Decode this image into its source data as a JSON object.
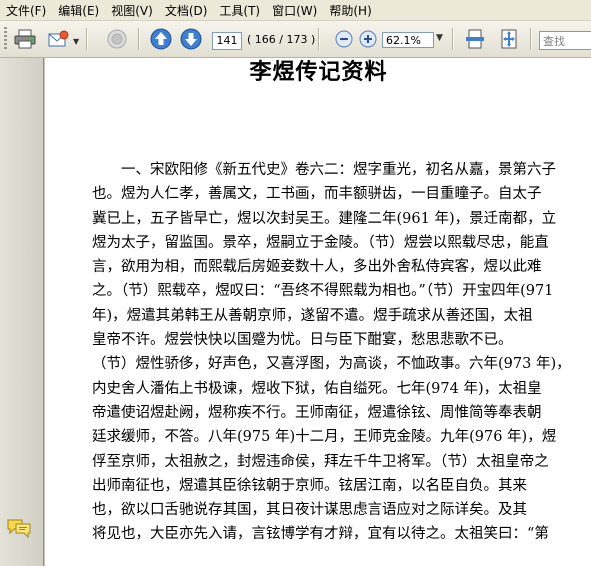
{
  "menu": {
    "items": [
      "文件(F)",
      "编辑(E)",
      "视图(V)",
      "文档(D)",
      "工具(T)",
      "窗口(W)",
      "帮助(H)"
    ]
  },
  "toolbar": {
    "page_current": "141",
    "page_of": "( 166 / 173 )",
    "zoom": "62.1%",
    "zoom_dropdown_arrow": "▼",
    "search_placeholder": "查找",
    "icons": [
      "printer-icon",
      "email-icon",
      "disabled-circle-icon",
      "up-arrow-icon",
      "down-arrow-icon",
      "zoom-out-icon",
      "zoom-in-icon",
      "fit-width-icon",
      "fit-page-icon"
    ]
  },
  "document": {
    "title": "李煜传记资料",
    "lines": [
      "　　一、宋欧阳修《新五代史》卷六二：煜字重光，初名从嘉，景第六子",
      "也。煜为人仁孝，善属文，工书画，而丰额骈齿，一目重瞳子。自太子",
      "冀已上，五子皆早亡，煜以次封吴王。建隆二年(961 年)，景迁南都，立",
      "煜为太子，留监国。景卒，煜嗣立于金陵。（节）煜尝以熙载尽忠，能直",
      "言，欲用为相，而熙载后房姬妾数十人，多出外舍私侍宾客，煜以此难",
      "之。（节）熙载卒，煜叹曰：“吾终不得熙载为相也。”（节）开宝四年(971",
      "年)，煜遣其弟韩王从善朝京师，遂留不遣。煜手疏求从善还国，太祖",
      "皇帝不许。煜尝快快以国蹙为忧。日与臣下酣宴，愁思悲歌不已。",
      "（节）煜性骄侈，好声色，又喜浮图，为高谈，不恤政事。六年(973 年)，",
      "内史舍人潘佑上书极谏，煜收下狱，佑自缢死。七年(974 年)，太祖皇",
      "帝遣使诏煜赴阙，煜称疾不行。王师南征，煜遣徐铉、周惟简等奉表朝",
      "廷求缓师，不答。八年(975 年)十二月，王师克金陵。九年(976 年)，煜",
      "俘至京师，太祖赦之，封煜违命侯，拜左千牛卫将军。（节）太祖皇帝之",
      "出师南征也，煜遣其臣徐铉朝于京师。铉居江南，以名臣自负。其来",
      "也，欲以口舌驰说存其国，其日夜计谋思虑言语应对之际详矣。及其",
      "将见也，大臣亦先入请，言铉博学有才辩，宜有以待之。太祖笑曰：“第"
    ]
  },
  "colors": {
    "menubar_bg": "#ece9d8",
    "toolbar_bg": "#e8e5d9",
    "nav_bg": "#d6d4ca",
    "accent_blue": "#2a5db0"
  }
}
